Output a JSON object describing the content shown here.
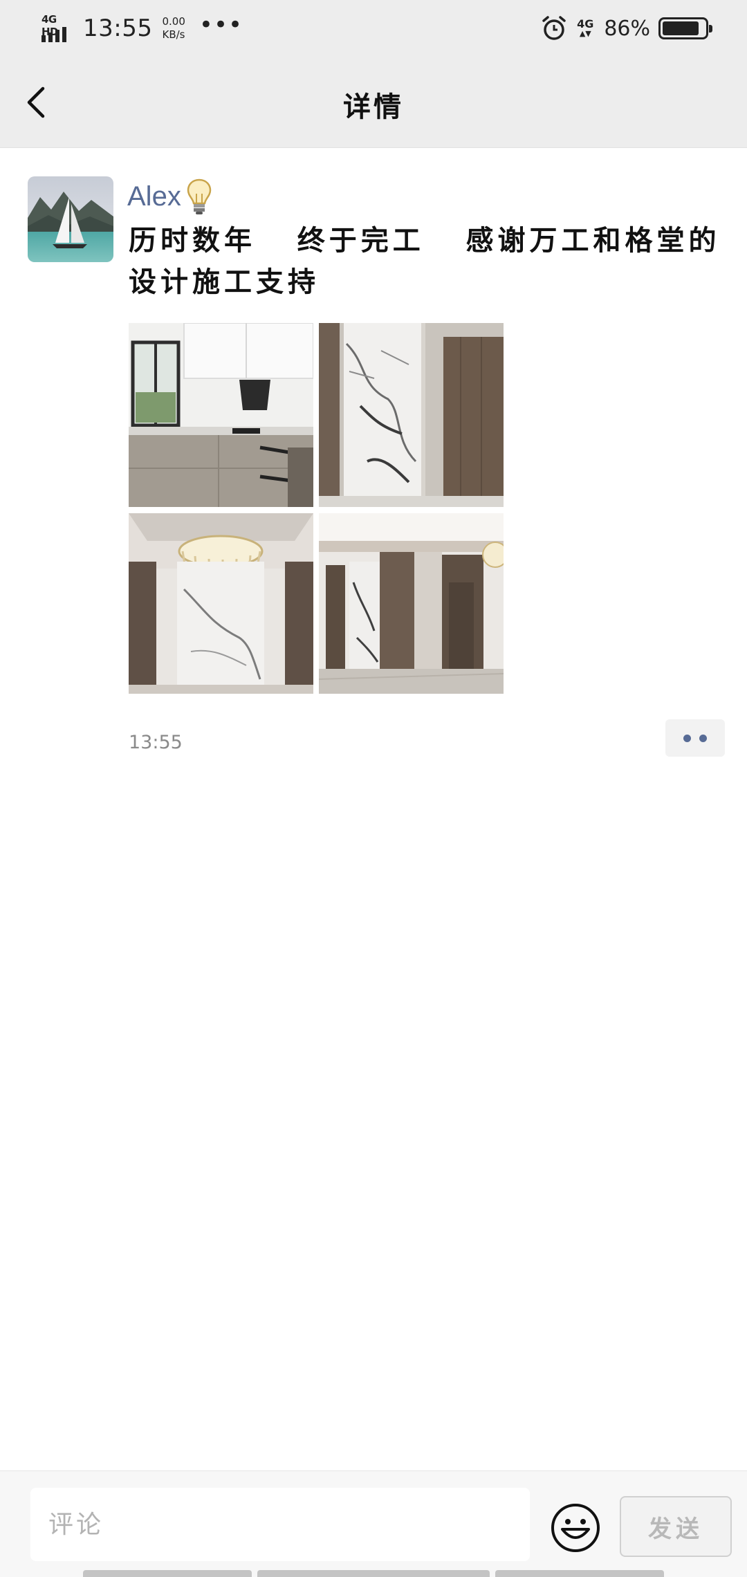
{
  "status_bar": {
    "network": "4G HD",
    "time": "13:55",
    "speed_value": "0.00",
    "speed_unit": "KB/s",
    "more": "•••",
    "right_network": "4G",
    "battery_percent": "86%",
    "battery_level": 0.86,
    "icons": [
      "signal-icon",
      "alarm-icon",
      "battery-icon"
    ]
  },
  "title_bar": {
    "title": "详情",
    "back_icon": "chevron-left-icon"
  },
  "post": {
    "author": "Alex",
    "author_badge_icon": "lightbulb-icon",
    "text": "历时数年   终于完工   感谢万工和格堂的设计施工支持",
    "photos": [
      {
        "name": "photo-kitchen"
      },
      {
        "name": "photo-marble-wall"
      },
      {
        "name": "photo-chandelier-wall"
      },
      {
        "name": "photo-hallway"
      }
    ],
    "time": "13:55",
    "more_icon": "more-dots-icon"
  },
  "comment_bar": {
    "placeholder": "评论",
    "emoji_icon": "smiley-icon",
    "send_label": "发送"
  },
  "colors": {
    "header_bg": "#ededed",
    "name_color": "#576b95",
    "time_color": "#8a8a8a"
  }
}
